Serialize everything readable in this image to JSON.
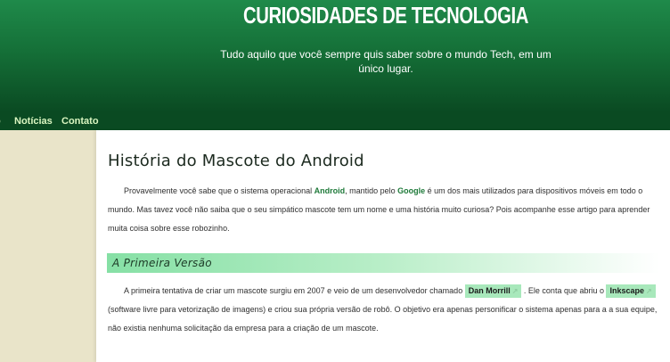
{
  "header": {
    "title": "CURIOSIDADES DE TECNOLOGIA",
    "subtitle": "Tudo aquilo que você sempre quis saber sobre o mundo Tech, em um único lugar."
  },
  "nav": {
    "items": [
      "o",
      "Notícias",
      "Contato"
    ]
  },
  "article": {
    "title": "História do Mascote do Android",
    "intro": {
      "t1": "Provavelmente você sabe que o sistema operacional ",
      "android": "Android",
      "t2": ", mantido pelo ",
      "google": "Google",
      "t3": " é um dos mais utilizados para dispositivos móveis em todo o mundo. Mas tavez você não saiba que o seu simpático mascote tem um nome e uma história muito curiosa? Pois acompanhe esse artigo para aprender muita coisa sobre esse robozinho."
    },
    "section": {
      "title": "A Primeira Versão",
      "t1": "A primeira tentativa de criar um mascote surgiu em 2007 e veio de um desenvolvedor chamado ",
      "tag1": "Dan Morrill",
      "t2": " . Ele conta que abriu o ",
      "tag2": "Inkscape",
      "t3": " (software livre para vetorização de imagens) e criou sua própria versão de robô. O objetivo era apenas personificar o sistema apenas para a a sua equipe, não existia nenhuma solicitação da empresa para a criação de um mascote."
    }
  },
  "colors": {
    "header_green": "#1f8a4a",
    "nav_dark_green": "#0a4a22",
    "nav_link": "#d9f5c0",
    "link_green": "#1f7a3a",
    "tag_bg": "#a8e8bb",
    "sidebar_beige": "#e9e4c9"
  },
  "icons": {
    "external_link": "external-link-icon"
  }
}
